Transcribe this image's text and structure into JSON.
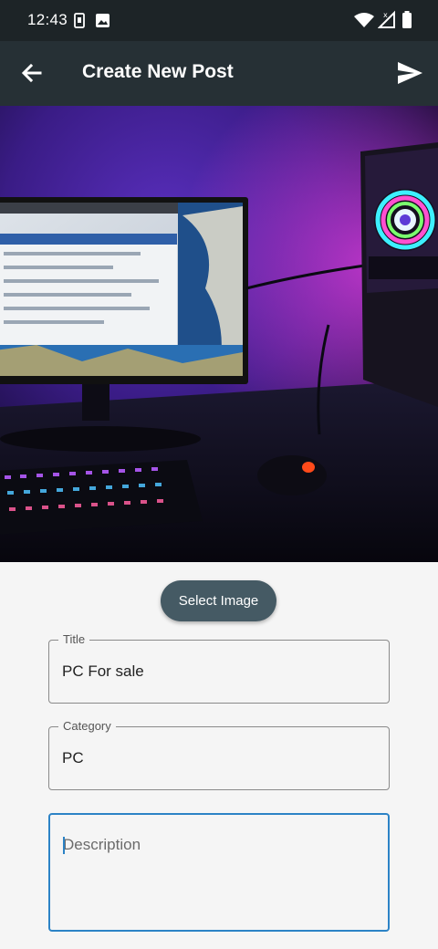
{
  "status_bar": {
    "time": "12:43",
    "left_icons": [
      "vibrate-icon",
      "image-icon"
    ],
    "right_icons": [
      "wifi-icon",
      "signal-no-service-icon",
      "battery-icon"
    ]
  },
  "app_bar": {
    "title": "Create New Post",
    "back_icon": "arrow-back-icon",
    "send_icon": "send-icon"
  },
  "form": {
    "select_image_label": "Select Image",
    "title": {
      "label": "Title",
      "value": "PC For sale"
    },
    "category": {
      "label": "Category",
      "value": "PC"
    },
    "description": {
      "placeholder": "Description",
      "value": ""
    }
  },
  "colors": {
    "status_bar": "#1d2427",
    "app_bar": "#263035",
    "button": "#455a64",
    "focus": "#2c83c6"
  }
}
